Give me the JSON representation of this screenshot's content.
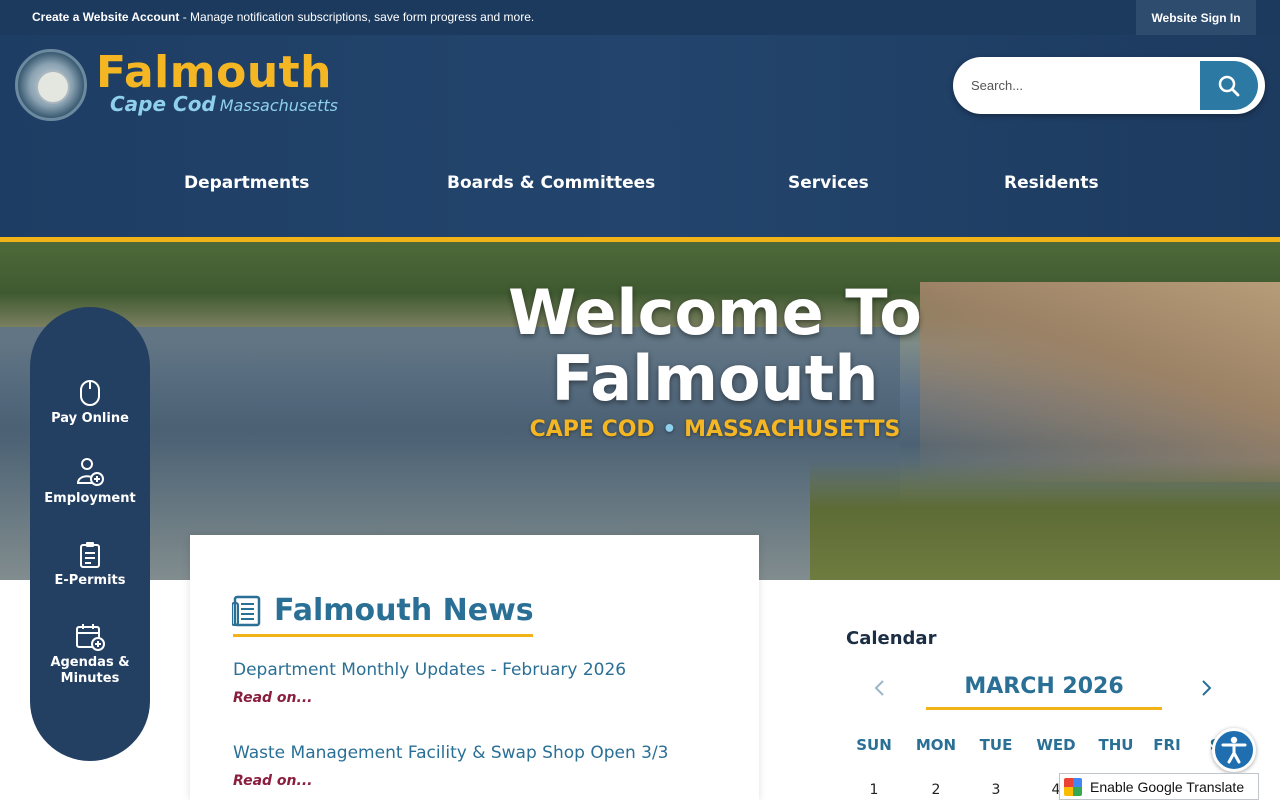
{
  "topbar": {
    "account_bold": "Create a Website Account",
    "account_rest": " - Manage notification subscriptions, save form progress and more.",
    "signin": "Website Sign In"
  },
  "brand": {
    "name": "Falmouth",
    "sub_cc": "Cape Cod",
    "sub_ma": "Massachusetts"
  },
  "search": {
    "placeholder": "Search..."
  },
  "nav": {
    "items": [
      {
        "label": "Departments"
      },
      {
        "label": "Boards & Committees"
      },
      {
        "label": "Services"
      },
      {
        "label": "Residents"
      }
    ]
  },
  "hero": {
    "title_line1": "Welcome To",
    "title_line2": "Falmouth",
    "sub_left": "CAPE COD",
    "sub_dot": "•",
    "sub_right": "MASSACHUSETTS"
  },
  "quick_links": {
    "items": [
      {
        "label": "Pay Online",
        "icon": "mouse-icon"
      },
      {
        "label": "Employment",
        "icon": "person-add-icon"
      },
      {
        "label": "E-Permits",
        "icon": "clipboard-icon"
      },
      {
        "label": "Agendas & Minutes",
        "icon": "calendar-add-icon"
      }
    ]
  },
  "news": {
    "title": "Falmouth News",
    "articles": [
      {
        "title": "Department Monthly Updates - February 2026",
        "more": "Read on..."
      },
      {
        "title": "Waste Management Facility & Swap Shop Open 3/3",
        "more": "Read on..."
      }
    ]
  },
  "calendar": {
    "label": "Calendar",
    "month": "MARCH 2026",
    "days": [
      "SUN",
      "MON",
      "TUE",
      "WED",
      "THU",
      "FRI",
      "SA"
    ],
    "dates": [
      "1",
      "2",
      "3",
      "4"
    ]
  },
  "translate": {
    "label": "Enable Google Translate"
  },
  "colors": {
    "navy": "#1c3a5e",
    "gold": "#f2b318",
    "accent_blue": "#2a6f95",
    "readmore": "#8a1e3e"
  }
}
